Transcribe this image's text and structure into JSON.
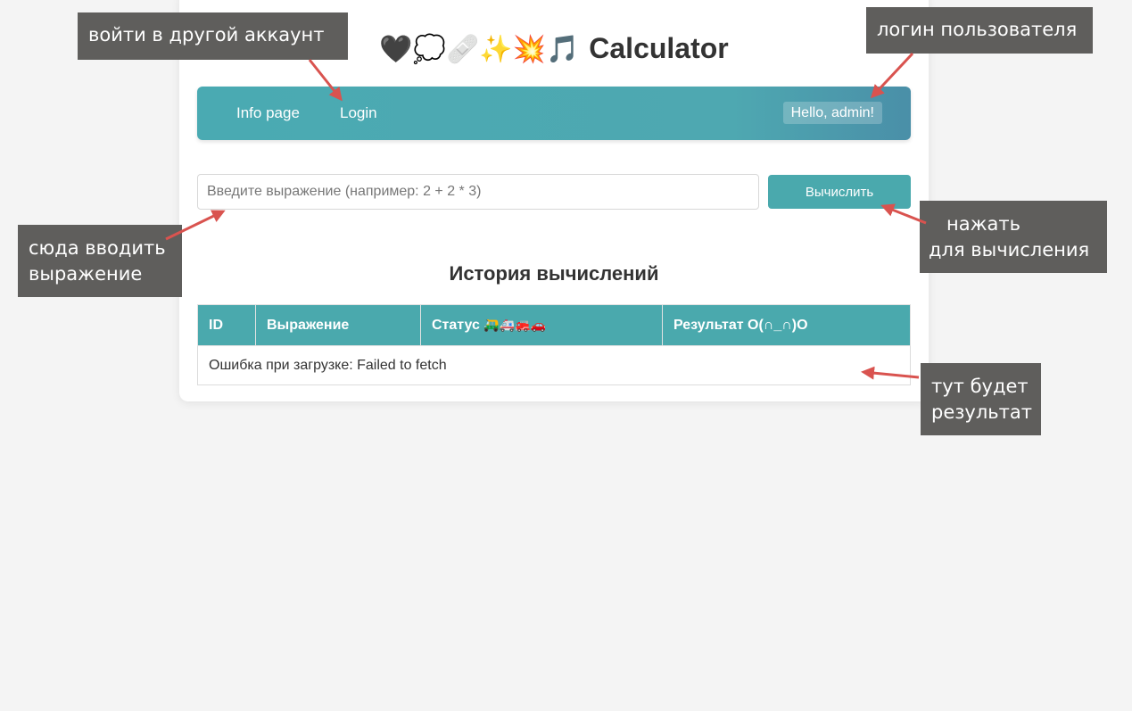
{
  "app": {
    "title_emojis": "🖤💭🩹✨💥🎵",
    "title_text": "Calculator"
  },
  "nav": {
    "items": [
      {
        "label": "Info page"
      },
      {
        "label": "Login"
      }
    ],
    "greeting": "Hello, admin!"
  },
  "calc": {
    "input_placeholder": "Введите выражение (например: 2 + 2 * 3)",
    "input_value": "",
    "button_label": "Вычислить"
  },
  "history": {
    "title": "История вычислений",
    "columns": [
      {
        "label": "ID"
      },
      {
        "label": "Выражение"
      },
      {
        "label": "Статус",
        "emojis": "🛺🚑🚒🚗"
      },
      {
        "label": "Результат O(∩_∩)O"
      }
    ],
    "error_message": "Ошибка при загрузке: Failed to fetch"
  },
  "annotations": {
    "switch_account": "войти в другой аккаунт",
    "user_login": "логин пользователя",
    "enter_expression_line1": "сюда вводить",
    "enter_expression_line2": "выражение",
    "press_line1": "нажать",
    "press_line2": "для вычисления",
    "result_line1": "тут будет",
    "result_line2": "результат",
    "arrow_color": "#d9534f"
  }
}
